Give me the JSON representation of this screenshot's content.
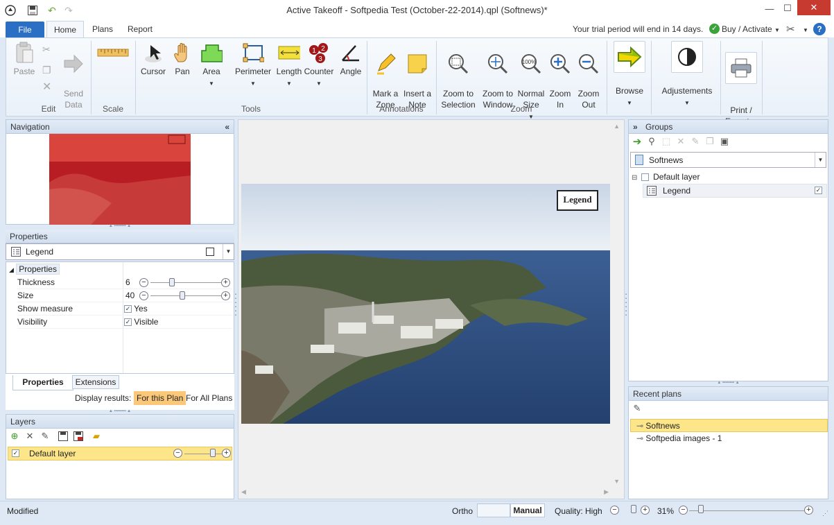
{
  "window": {
    "title": "Active Takeoff - Softpedia Test (October-22-2014).qpl (Softnews)*",
    "minimize": "—",
    "maximize": "☐",
    "close": "✕"
  },
  "tabs": [
    {
      "label": "File"
    },
    {
      "label": "Home"
    },
    {
      "label": "Plans"
    },
    {
      "label": "Report"
    }
  ],
  "trial": {
    "message": "Your trial period will end in 14 days.",
    "buy_label": "Buy / Activate"
  },
  "ribbon": {
    "groups": {
      "edit": "Edit",
      "scale": "Scale",
      "tools": "Tools",
      "annotations": "Annotations",
      "zoom": "Zoom"
    },
    "paste": "Paste",
    "send_data": "Send\nData",
    "cursor": "Cursor",
    "pan": "Pan",
    "area": "Area",
    "perimeter": "Perimeter",
    "length": "Length",
    "counter": "Counter",
    "angle": "Angle",
    "mark_zone": "Mark a\nZone",
    "insert_note": "Insert a\nNote",
    "zoom_selection": "Zoom to\nSelection",
    "zoom_window": "Zoom to\nWindow",
    "normal_size": "Normal\nSize",
    "zoom_in": "Zoom\nIn",
    "zoom_out": "Zoom\nOut",
    "browse": "Browse",
    "adjustements": "Adjustements",
    "print_export": "Print /\nExport",
    "normal_icon_text": "100%",
    "counter_numbers": [
      "1",
      "2",
      "3"
    ]
  },
  "navigation": {
    "title": "Navigation",
    "collapse": "«"
  },
  "properties": {
    "title": "Properties",
    "selected": "Legend",
    "section": "Properties",
    "rows": [
      {
        "name": "Thickness",
        "value": "6",
        "level": 0.3
      },
      {
        "name": "Size",
        "value": "40",
        "level": 0.45
      },
      {
        "name": "Show measure",
        "value": "Yes",
        "checked": true
      },
      {
        "name": "Visibility",
        "value": "Visible",
        "checked": true
      }
    ],
    "tabs": [
      "Properties",
      "Extensions"
    ],
    "display_label": "Display results:",
    "display_options": [
      "For this Plan",
      "For All Plans"
    ]
  },
  "layers": {
    "title": "Layers",
    "items": [
      {
        "name": "Default layer",
        "checked": true,
        "opacity": 0.75
      }
    ]
  },
  "canvas": {
    "legend_label": "Legend"
  },
  "groups": {
    "title": "Groups",
    "expand": "»",
    "selector": "Softnews",
    "tree": [
      {
        "name": "Default layer",
        "expander": "⊟"
      },
      {
        "name": "Legend",
        "checked": true
      }
    ]
  },
  "recent": {
    "title": "Recent plans",
    "items": [
      "Softnews",
      "Softpedia images - 1"
    ]
  },
  "status": {
    "left": "Modified",
    "ortho": "Ortho",
    "manual": "Manual",
    "quality": "Quality: High",
    "zoom": "31%"
  },
  "colors": {
    "accent": "#2b6fc4",
    "highlight": "#fde58a",
    "selected_option": "#fbc87a"
  }
}
